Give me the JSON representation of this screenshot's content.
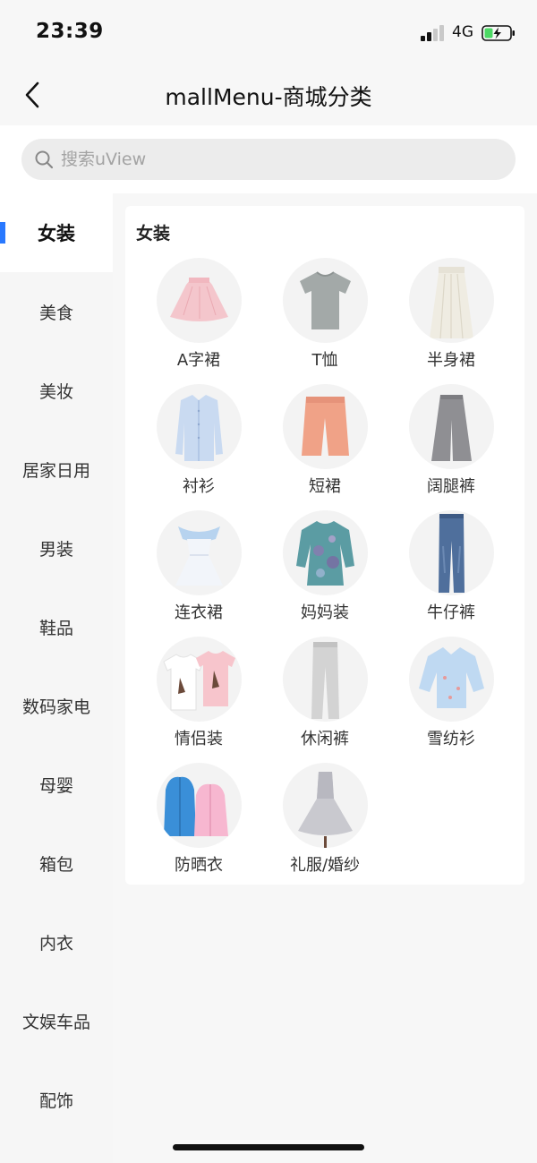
{
  "status_bar": {
    "time": "23:39",
    "network": "4G"
  },
  "nav": {
    "title": "mallMenu-商城分类"
  },
  "search": {
    "placeholder": "搜索uView"
  },
  "sidebar": {
    "items": [
      {
        "label": "女装",
        "active": true
      },
      {
        "label": "美食"
      },
      {
        "label": "美妆"
      },
      {
        "label": "居家日用"
      },
      {
        "label": "男装"
      },
      {
        "label": "鞋品"
      },
      {
        "label": "数码家电"
      },
      {
        "label": "母婴"
      },
      {
        "label": "箱包"
      },
      {
        "label": "内衣"
      },
      {
        "label": "文娱车品"
      },
      {
        "label": "配饰"
      }
    ]
  },
  "section": {
    "title": "女装",
    "items": [
      {
        "label": "A字裙",
        "icon": "a-line-skirt-icon"
      },
      {
        "label": "T恤",
        "icon": "tshirt-icon"
      },
      {
        "label": "半身裙",
        "icon": "midi-skirt-icon"
      },
      {
        "label": "衬衫",
        "icon": "shirt-icon"
      },
      {
        "label": "短裙",
        "icon": "shorts-icon"
      },
      {
        "label": "阔腿裤",
        "icon": "wide-pants-icon"
      },
      {
        "label": "连衣裙",
        "icon": "dress-icon"
      },
      {
        "label": "妈妈装",
        "icon": "tunic-icon"
      },
      {
        "label": "牛仔裤",
        "icon": "jeans-icon"
      },
      {
        "label": "情侣装",
        "icon": "couple-tshirt-icon"
      },
      {
        "label": "休闲裤",
        "icon": "casual-pants-icon"
      },
      {
        "label": "雪纺衫",
        "icon": "chiffon-blouse-icon"
      },
      {
        "label": "防晒衣",
        "icon": "sun-jacket-icon"
      },
      {
        "label": "礼服/婚纱",
        "icon": "gown-icon"
      }
    ]
  },
  "colors": {
    "accent": "#2979ff"
  }
}
